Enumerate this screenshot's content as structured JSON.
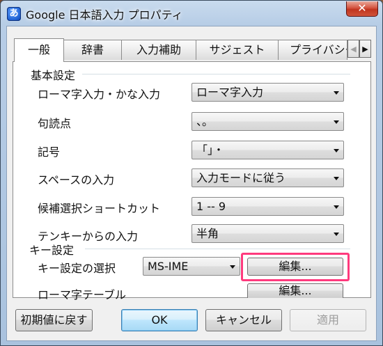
{
  "window": {
    "title": "Google 日本語入力 プロパティ",
    "app_icon_glyph": "あ",
    "close_glyph": "✕"
  },
  "tabs": [
    {
      "label": "一般",
      "active": true
    },
    {
      "label": "辞書",
      "active": false
    },
    {
      "label": "入力補助",
      "active": false
    },
    {
      "label": "サジェスト",
      "active": false
    },
    {
      "label": "プライバシー",
      "active": false
    }
  ],
  "tab_scroll": {
    "left_glyph": "◀",
    "right_glyph": "▶"
  },
  "basic_settings": {
    "title": "基本設定",
    "rows": [
      {
        "label": "ローマ字入力・かな入力",
        "value": "ローマ字入力"
      },
      {
        "label": "句読点",
        "value": "、。"
      },
      {
        "label": "記号",
        "value": "「」・"
      },
      {
        "label": "スペースの入力",
        "value": "入力モードに従う"
      },
      {
        "label": "候補選択ショートカット",
        "value": "1 -- 9"
      },
      {
        "label": "テンキーからの入力",
        "value": "半角"
      }
    ]
  },
  "key_settings": {
    "title": "キー設定",
    "keymap_label": "キー設定の選択",
    "keymap_value": "MS-IME",
    "keymap_edit_label": "編集...",
    "romaji_table_label": "ローマ字テーブル",
    "romaji_edit_label": "編集..."
  },
  "footer": {
    "reset_label": "初期値に戻す",
    "ok_label": "OK",
    "cancel_label": "キャンセル",
    "apply_label": "適用"
  },
  "colors": {
    "highlight": "#ff3a7d",
    "title_bar": "#b7cde6",
    "close_button": "#c0351f"
  }
}
